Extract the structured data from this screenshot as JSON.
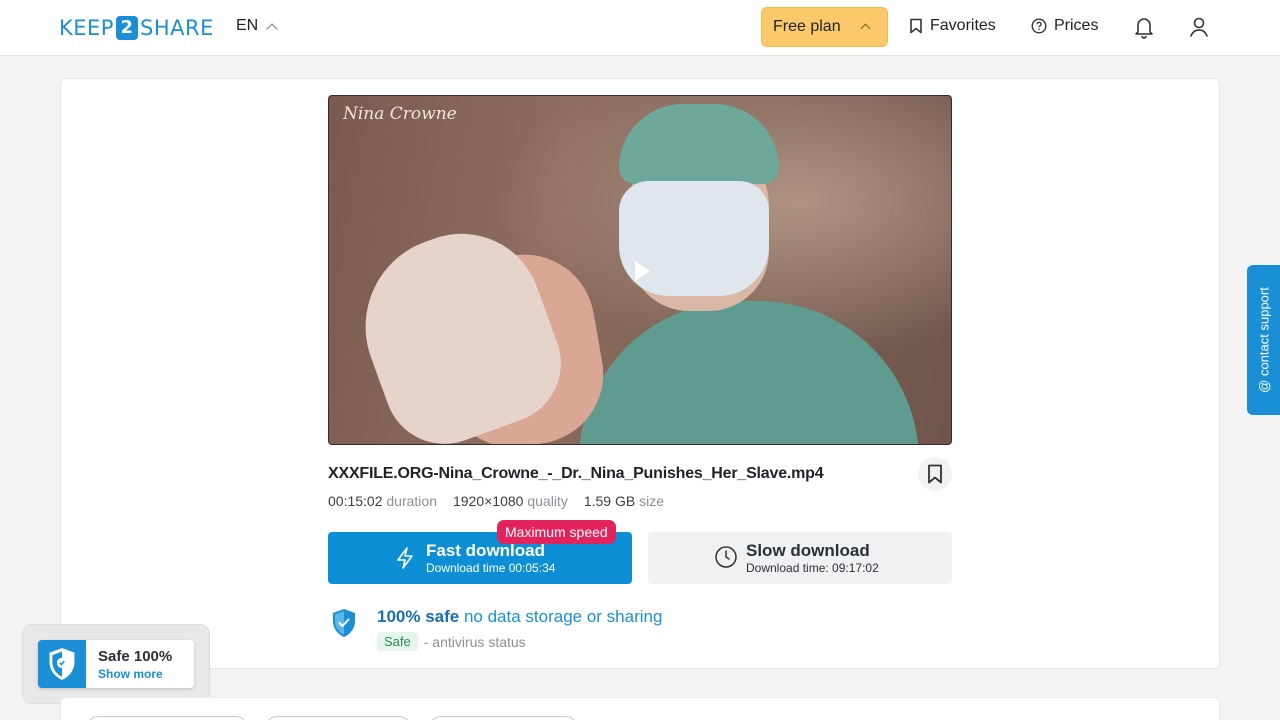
{
  "header": {
    "logo_left": "KEEP",
    "logo_mid": "2",
    "logo_right": "SHARE",
    "language": "EN",
    "plan_label": "Free plan",
    "favorites_label": "Favorites",
    "prices_label": "Prices"
  },
  "video": {
    "watermark": "Nina Crowne"
  },
  "file": {
    "name": "XXXFILE.ORG-Nina_Crowne_-_Dr._Nina_Punishes_Her_Slave.mp4",
    "duration_value": "00:15:02",
    "duration_label": "duration",
    "quality_value": "1920×1080",
    "quality_label": "quality",
    "size_value": "1.59 GB",
    "size_label": "size"
  },
  "download": {
    "max_speed_badge": "Maximum speed",
    "fast_label": "Fast download",
    "fast_time": "Download time 00:05:34",
    "slow_label": "Slow download",
    "slow_time": "Download time: 09:17:02"
  },
  "safety": {
    "headline_bold": "100% safe",
    "headline_rest": "no data storage or sharing",
    "antivirus_badge": "Safe",
    "antivirus_text": "- antivirus status"
  },
  "contact_support": "@ contact support",
  "safe_badge": {
    "title": "Safe 100%",
    "link": "Show more"
  },
  "colors": {
    "accent": "#0d8fd6",
    "plan_yellow": "#fbc96a",
    "badge_red": "#e3245c",
    "safe_green": "#2a8a55"
  }
}
